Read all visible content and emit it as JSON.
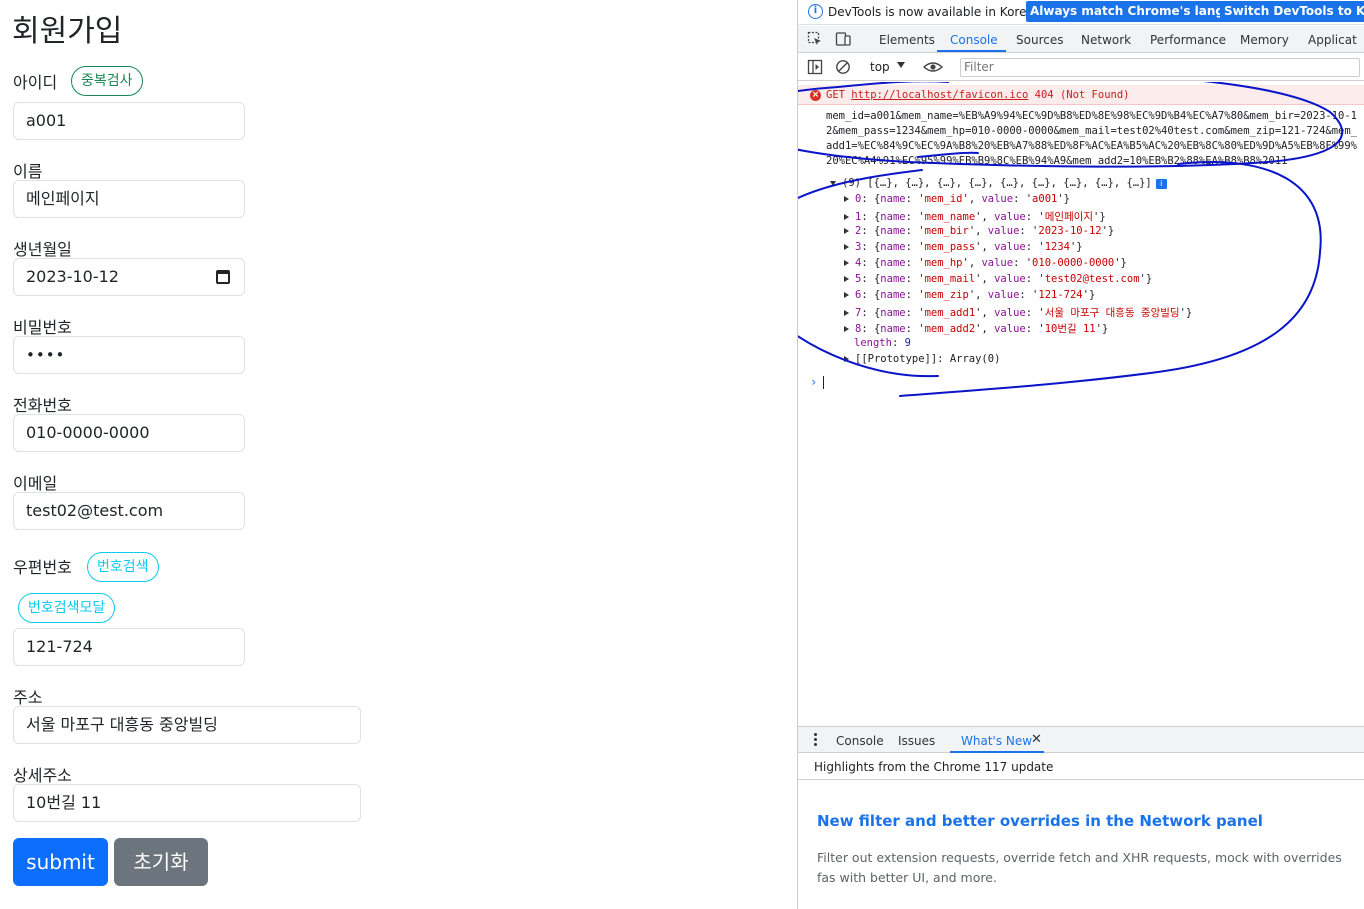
{
  "form": {
    "title": "회원가입",
    "id_label": "아이디",
    "dup_check_button": "중복검사",
    "id_value": "a001",
    "name_label": "이름",
    "name_value": "메인페이지",
    "birth_label": "생년월일",
    "birth_value": "2023-10-12",
    "pass_label": "비밀번호",
    "pass_value": "••••",
    "phone_label": "전화번호",
    "phone_value": "010-0000-0000",
    "email_label": "이메일",
    "email_value": "test02@test.com",
    "zip_label": "우편번호",
    "zip_search_button": "번호검색",
    "zip_modal_button": "번호검색모달",
    "zip_value": "121-724",
    "addr1_label": "주소",
    "addr1_value": "서울 마포구 대흥동 중앙빌딩",
    "addr2_label": "상세주소",
    "addr2_value": "10번길 11",
    "submit_label": "submit",
    "reset_label": "초기화"
  },
  "devtools": {
    "infobar": {
      "text": "DevTools is now available in Korean!",
      "btn_match": "Always match Chrome's language",
      "btn_switch": "Switch DevTools to Kor"
    },
    "tabs": [
      "Elements",
      "Console",
      "Sources",
      "Network",
      "Performance",
      "Memory",
      "Applicat"
    ],
    "active_tab": "Console",
    "toolbar": {
      "context": "top",
      "filter_placeholder": "Filter"
    },
    "error": {
      "method": "GET",
      "url": "http://localhost/favicon.ico",
      "status": "404",
      "status_text": "(Not Found)"
    },
    "query_string": "mem_id=a001&mem_name=%EB%A9%94%EC%9D%B8%ED%8E%98%EC%9D%B4%EC%A7%80&mem_bir=2023-10-12&mem_pass=1234&mem_hp=010-0000-0000&mem_mail=test02%40test.com&mem_zip=121-724&mem_add1=%EC%84%9C%EC%9A%B8%20%EB%A7%88%ED%8F%AC%EA%B5%AC%20%EB%8C%80%ED%9D%A5%EB%8F%99%20%EC%A4%91%EC%95%99%EB%B9%8C%EB%94%A9&mem_add2=10%EB%B2%88%EA%B8%B8%2011",
    "array_summary": "(9) [{…}, {…}, {…}, {…}, {…}, {…}, {…}, {…}, {…}]",
    "entries": [
      {
        "idx": "0",
        "name": "mem_id",
        "value": "a001"
      },
      {
        "idx": "1",
        "name": "mem_name",
        "value": "메인페이지"
      },
      {
        "idx": "2",
        "name": "mem_bir",
        "value": "2023-10-12"
      },
      {
        "idx": "3",
        "name": "mem_pass",
        "value": "1234"
      },
      {
        "idx": "4",
        "name": "mem_hp",
        "value": "010-0000-0000"
      },
      {
        "idx": "5",
        "name": "mem_mail",
        "value": "test02@test.com"
      },
      {
        "idx": "6",
        "name": "mem_zip",
        "value": "121-724"
      },
      {
        "idx": "7",
        "name": "mem_add1",
        "value": "서울 마포구 대흥동 중앙빌딩"
      },
      {
        "idx": "8",
        "name": "mem_add2",
        "value": "10번길 11"
      }
    ],
    "length_label": "length",
    "length_value": "9",
    "prototype": "[[Prototype]]: Array(0)",
    "drawer_tabs": [
      "Console",
      "Issues",
      "What's New"
    ],
    "drawer_active": "What's New",
    "whatsnew_header": "Highlights from the Chrome 117 update",
    "whatsnew_title": "New filter and better overrides in the Network panel",
    "whatsnew_body": "Filter out extension requests, override fetch and XHR requests, mock with overrides fas with better UI, and more."
  },
  "colors": {
    "primary": "#0d6efd",
    "secondary": "#6c757d",
    "success": "#198754",
    "info": "#0dcaf0",
    "devtools_accent": "#1a73e8",
    "annotation_ink": "#0a14c8"
  }
}
